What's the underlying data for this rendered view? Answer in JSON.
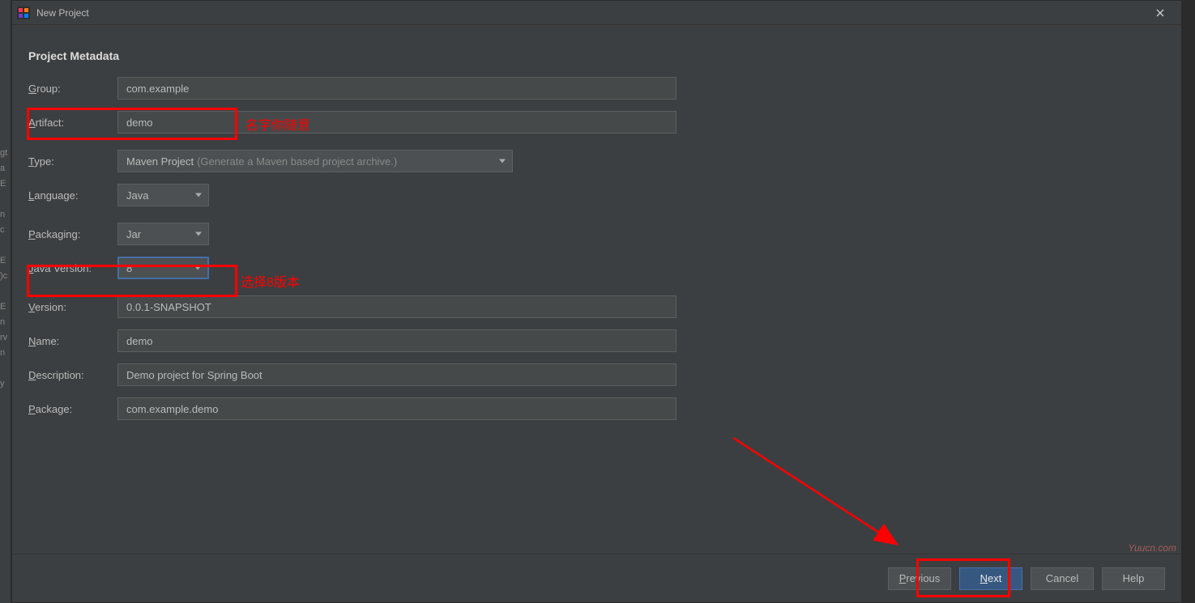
{
  "window": {
    "title": "New Project"
  },
  "heading": "Project Metadata",
  "labels": {
    "group": "roup:",
    "artifact": "rtifact:",
    "type": "ype:",
    "language": "anguage:",
    "packaging": "ackaging:",
    "javaVersion": "ava Version:",
    "version": "ersion:",
    "name": "ame:",
    "description": "escription:",
    "package": "ackage:"
  },
  "mnemonics": {
    "group": "G",
    "artifact": "A",
    "type": "T",
    "language": "L",
    "packaging": "P",
    "javaVersion": "J",
    "version": "V",
    "name": "N",
    "description": "D",
    "package": "P",
    "previous": "P",
    "next": "N"
  },
  "fields": {
    "group": "com.example",
    "artifact": "demo",
    "type": "Maven Project",
    "typeHint": "(Generate a Maven based project archive.)",
    "language": "Java",
    "packaging": "Jar",
    "javaVersion": "8",
    "version": "0.0.1-SNAPSHOT",
    "name": "demo",
    "description": "Demo project for Spring Boot",
    "package": "com.example.demo"
  },
  "buttons": {
    "previous": "revious",
    "next": "ext",
    "cancel": "Cancel",
    "help": "Help"
  },
  "annotations": {
    "artifact": "名字你随意",
    "java": "选择8版本"
  },
  "watermark": "Yuucn.com",
  "leftStrip": "gt\na\nE\n\nn\nc\n\nE\n)c\n\nE\nn\nrv\nn\n\ny"
}
